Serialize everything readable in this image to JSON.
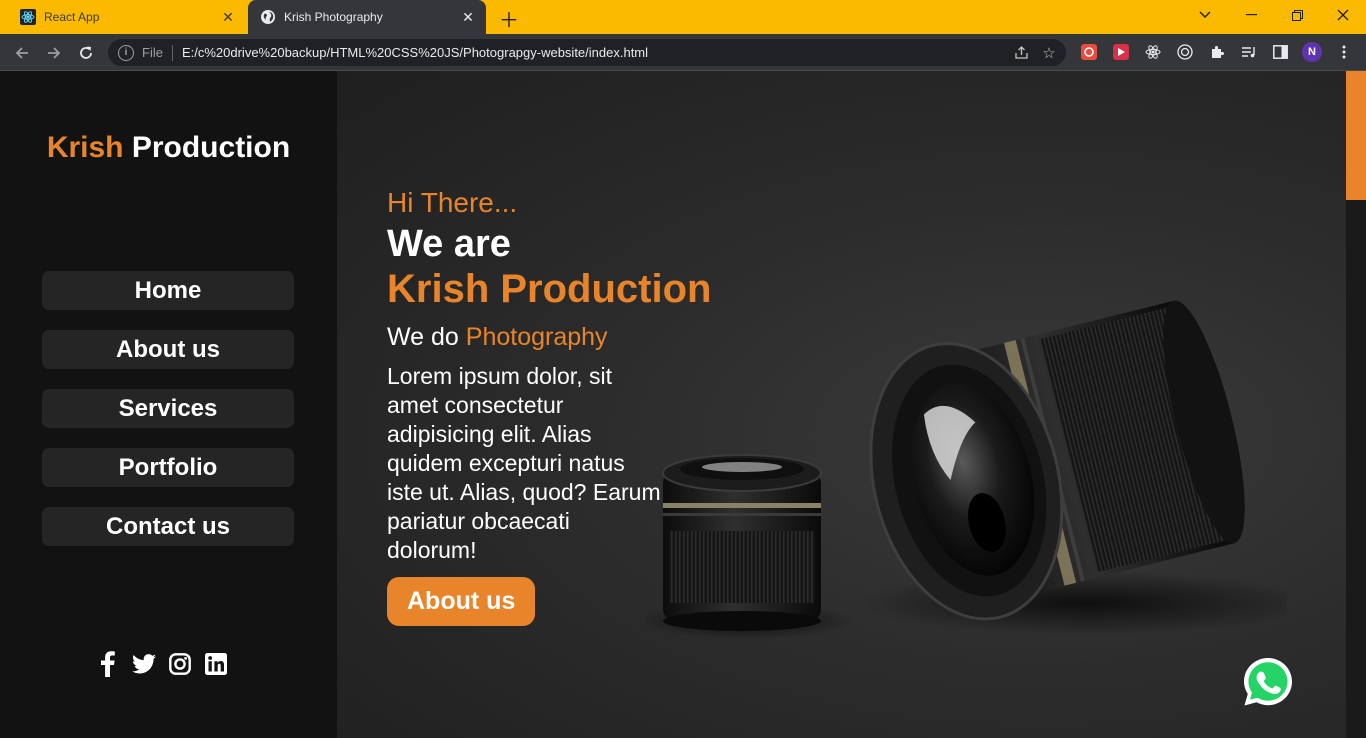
{
  "browser": {
    "tabs": [
      {
        "title": "React App",
        "active": false
      },
      {
        "title": "Krish Photography",
        "active": true
      }
    ],
    "address": {
      "scheme_label": "File",
      "url": "E:/c%20drive%20backup/HTML%20CSS%20JS/Photograpgy-website/index.html"
    },
    "profile_initial": "N"
  },
  "sidebar": {
    "brand_first": "Krish",
    "brand_second": "Production",
    "menu": [
      "Home",
      "About us",
      "Services",
      "Portfolio",
      "Contact us"
    ],
    "socials": [
      "facebook-icon",
      "twitter-icon",
      "instagram-icon",
      "linkedin-icon"
    ]
  },
  "hero": {
    "greeting": "Hi There...",
    "we_are": "We are",
    "company": "Krish Production",
    "we_do_prefix": "We do",
    "we_do_accent": "Photography",
    "description": "Lorem ipsum dolor, sit amet consectetur adipisicing elit. Alias quidem excepturi natus iste ut. Alias, quod? Earum pariatur obcaecati dolorum!",
    "cta_label": "About us"
  },
  "colors": {
    "accent": "#e8852a",
    "sidebar_bg": "#121212",
    "tabstrip": "#fbb900",
    "whatsapp": "#25d366"
  }
}
